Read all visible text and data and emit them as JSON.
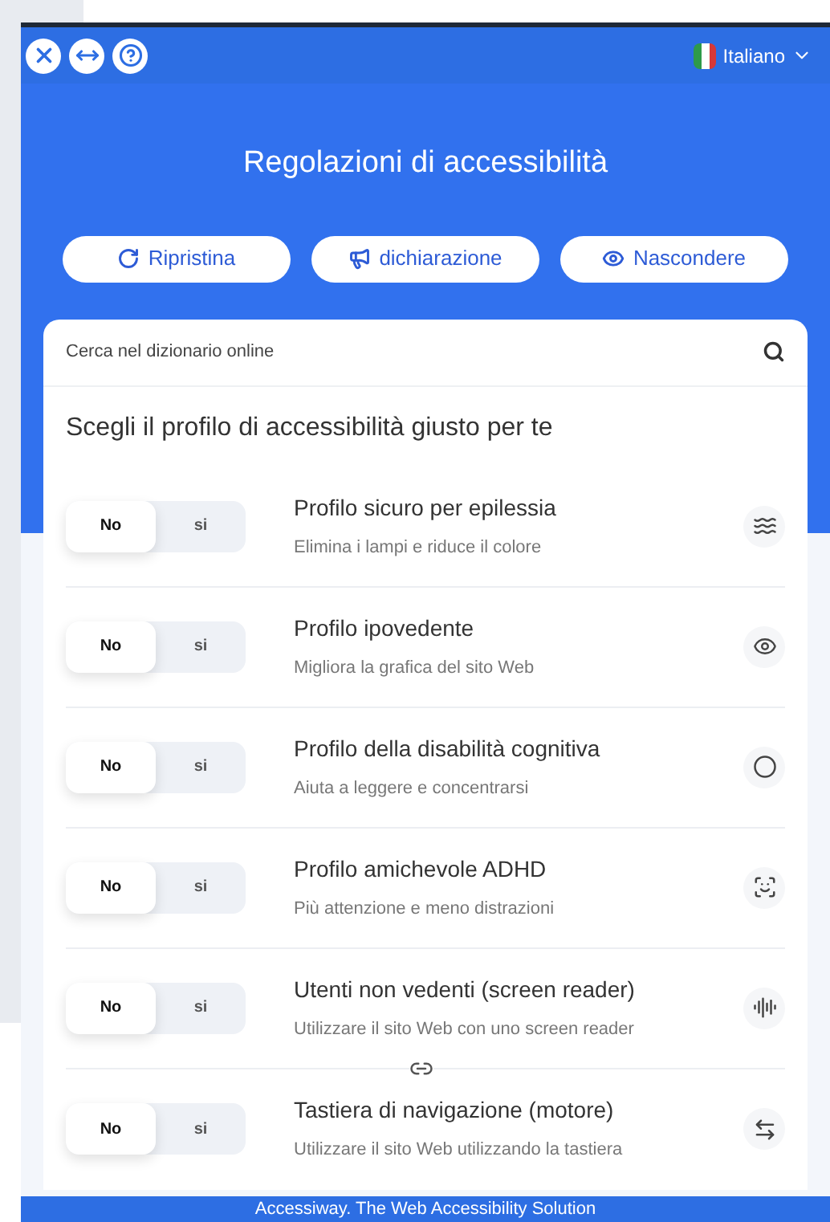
{
  "header": {
    "language": "Italiano"
  },
  "title": "Regolazioni di accessibilità",
  "actions": [
    {
      "kind": "reset",
      "label": "Ripristina"
    },
    {
      "kind": "statement",
      "label": "dichiarazione"
    },
    {
      "kind": "hide",
      "label": "Nascondere"
    }
  ],
  "search": {
    "placeholder": "Cerca nel dizionario online"
  },
  "profiles_heading": "Scegli il profilo di accessibilità giusto per te",
  "profiles": [
    {
      "kind": "epilepsy",
      "title": "Profilo sicuro per epilessia",
      "subtitle": "Elimina i lampi e riduce il colore",
      "options": [
        {
          "label": "No",
          "selected": true
        },
        {
          "label": "si",
          "selected": false
        }
      ]
    },
    {
      "kind": "vision",
      "title": "Profilo ipovedente",
      "subtitle": "Migliora la grafica del sito Web",
      "options": [
        {
          "label": "No",
          "selected": true
        },
        {
          "label": "si",
          "selected": false
        }
      ]
    },
    {
      "kind": "cognitive",
      "title": "Profilo della disabilità cognitiva",
      "subtitle": "Aiuta a leggere e concentrarsi",
      "options": [
        {
          "label": "No",
          "selected": true
        },
        {
          "label": "si",
          "selected": false
        }
      ]
    },
    {
      "kind": "adhd",
      "title": "Profilo amichevole ADHD",
      "subtitle": "Più attenzione e meno distrazioni",
      "options": [
        {
          "label": "No",
          "selected": true
        },
        {
          "label": "si",
          "selected": false
        }
      ]
    },
    {
      "kind": "blind",
      "title": "Utenti non vedenti (screen reader)",
      "subtitle": "Utilizzare il sito Web con uno screen reader",
      "options": [
        {
          "label": "No",
          "selected": true
        },
        {
          "label": "si",
          "selected": false
        }
      ]
    },
    {
      "kind": "keyboard",
      "title": "Tastiera di navigazione (motore)",
      "subtitle": "Utilizzare il sito Web utilizzando la tastiera",
      "options": [
        {
          "label": "No",
          "selected": true
        },
        {
          "label": "si",
          "selected": false
        }
      ]
    }
  ],
  "footer": "Accessiway. The Web Accessibility Solution"
}
